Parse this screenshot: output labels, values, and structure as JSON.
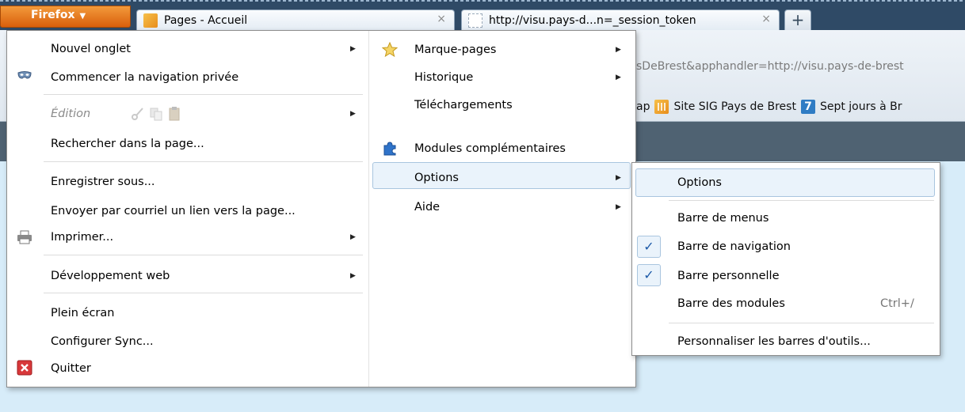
{
  "firefox_button": {
    "label": "Firefox"
  },
  "tabs": [
    {
      "title": "Pages - Accueil",
      "close": "×"
    },
    {
      "title": "http://visu.pays-d...n=_session_token",
      "close": "×"
    }
  ],
  "new_tab": "+",
  "navbar": {
    "url_fragment": "sDeBrest&apphandler=http://visu.pays-de-brest",
    "bookmarks": [
      "ap",
      "Site SIG Pays de Brest",
      "Sept jours à Br"
    ],
    "bookmark_badge": "7"
  },
  "menu_left": {
    "new_tab": "Nouvel onglet",
    "private": "Commencer la navigation privée",
    "edit": "Édition",
    "find": "Rechercher dans la page...",
    "save_as": "Enregistrer sous...",
    "send_link": "Envoyer par courriel un lien vers la page...",
    "print": "Imprimer...",
    "web_dev": "Développement web",
    "fullscreen": "Plein écran",
    "sync": "Configurer Sync...",
    "quit": "Quitter"
  },
  "menu_right": {
    "bookmarks": "Marque-pages",
    "history": "Historique",
    "downloads": "Téléchargements",
    "addons": "Modules complémentaires",
    "options": "Options",
    "help": "Aide"
  },
  "options_submenu": {
    "options": "Options",
    "menu_bar": "Barre de menus",
    "nav_bar": "Barre de navigation",
    "personal_bar": "Barre personnelle",
    "addon_bar": "Barre des modules",
    "addon_bar_shortcut": "Ctrl+/",
    "customize": "Personnaliser les barres d'outils...",
    "check_mark": "✓"
  },
  "submenu_arrow": "▶",
  "colors": {
    "firefox_orange": "#e87518",
    "menu_highlight": "#eaf3fb",
    "check_blue": "#1d5aa8"
  }
}
